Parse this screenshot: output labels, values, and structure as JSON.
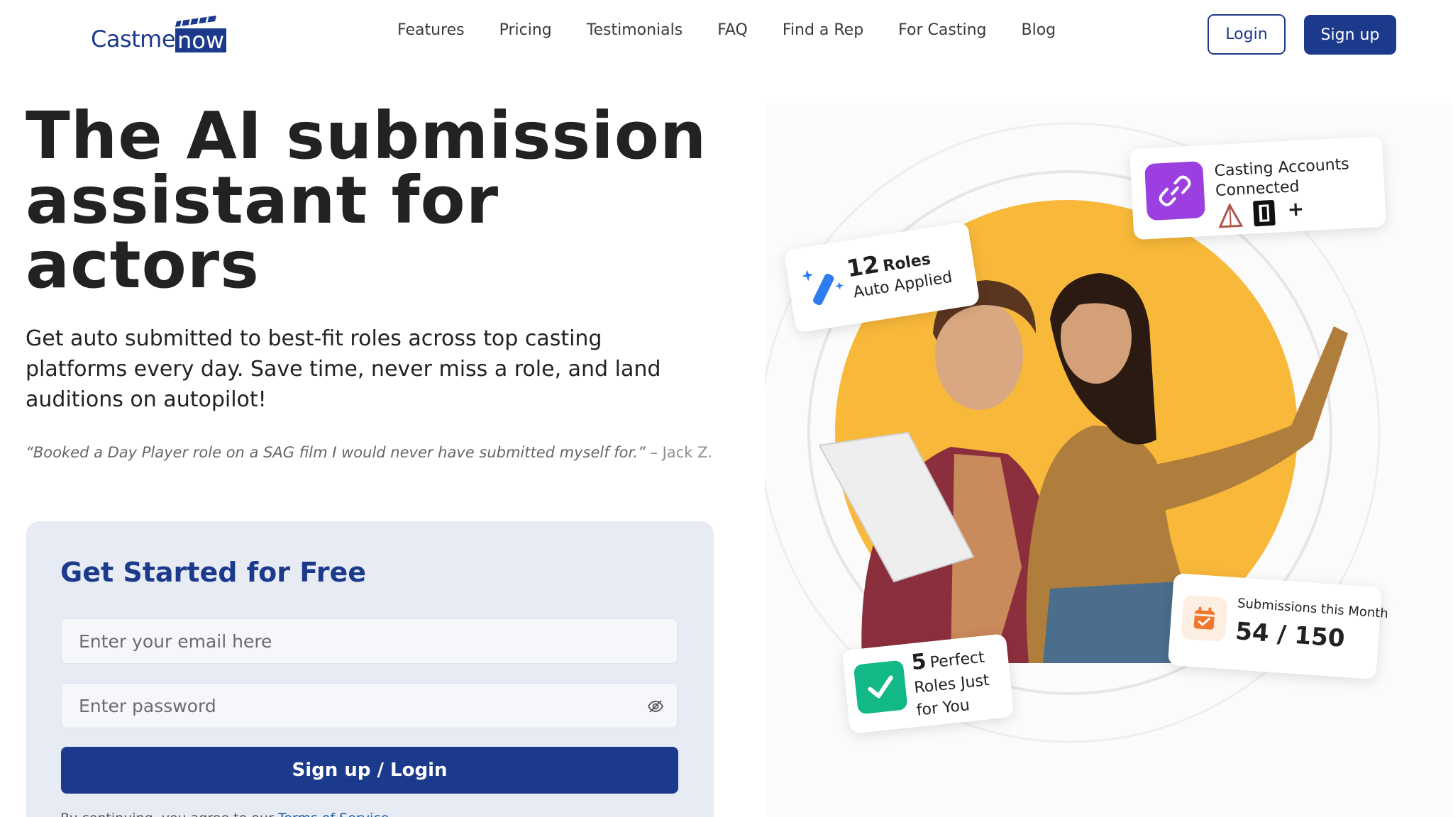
{
  "brand": {
    "logo_text": "Castme",
    "logo_now": "now"
  },
  "nav": {
    "links": [
      "Features",
      "Pricing",
      "Testimonials",
      "FAQ",
      "Find a Rep",
      "For Casting",
      "Blog"
    ],
    "login_label": "Login",
    "signup_label": "Sign up"
  },
  "hero": {
    "title_line1": "The AI submission",
    "title_line2": "assistant for",
    "title_line3": "actors",
    "subtitle": "Get auto submitted to best-fit roles across top casting platforms every day. Save time, never miss a role, and land auditions on autopilot!",
    "quote_text": "“Booked a Day Player role on a SAG film I would never have submitted myself for.”",
    "quote_author": " – Jack Z."
  },
  "form": {
    "title": "Get Started for Free",
    "email_placeholder": "Enter your email here",
    "password_placeholder": "Enter password",
    "submit_label": "Sign up / Login",
    "terms_prefix": "By continuing, you agree to our ",
    "terms_link": "Terms of Service"
  },
  "badges": {
    "roles_num": "12",
    "roles_word": "Roles",
    "roles_sub": "Auto Applied",
    "accounts_line1": "Casting Accounts",
    "accounts_line2": "Connected",
    "accounts_plus": "+",
    "perfect_num": "5",
    "perfect_word": "Perfect",
    "perfect_line2": "Roles Just",
    "perfect_line3": "for You",
    "subs_label": "Submissions this Month",
    "subs_value": "54 / 150"
  },
  "colors": {
    "brand_navy": "#1c3a8c",
    "accent_yellow": "#f8b93a",
    "purple": "#9b3fe0",
    "green": "#12b886",
    "orange": "#f0762a"
  }
}
